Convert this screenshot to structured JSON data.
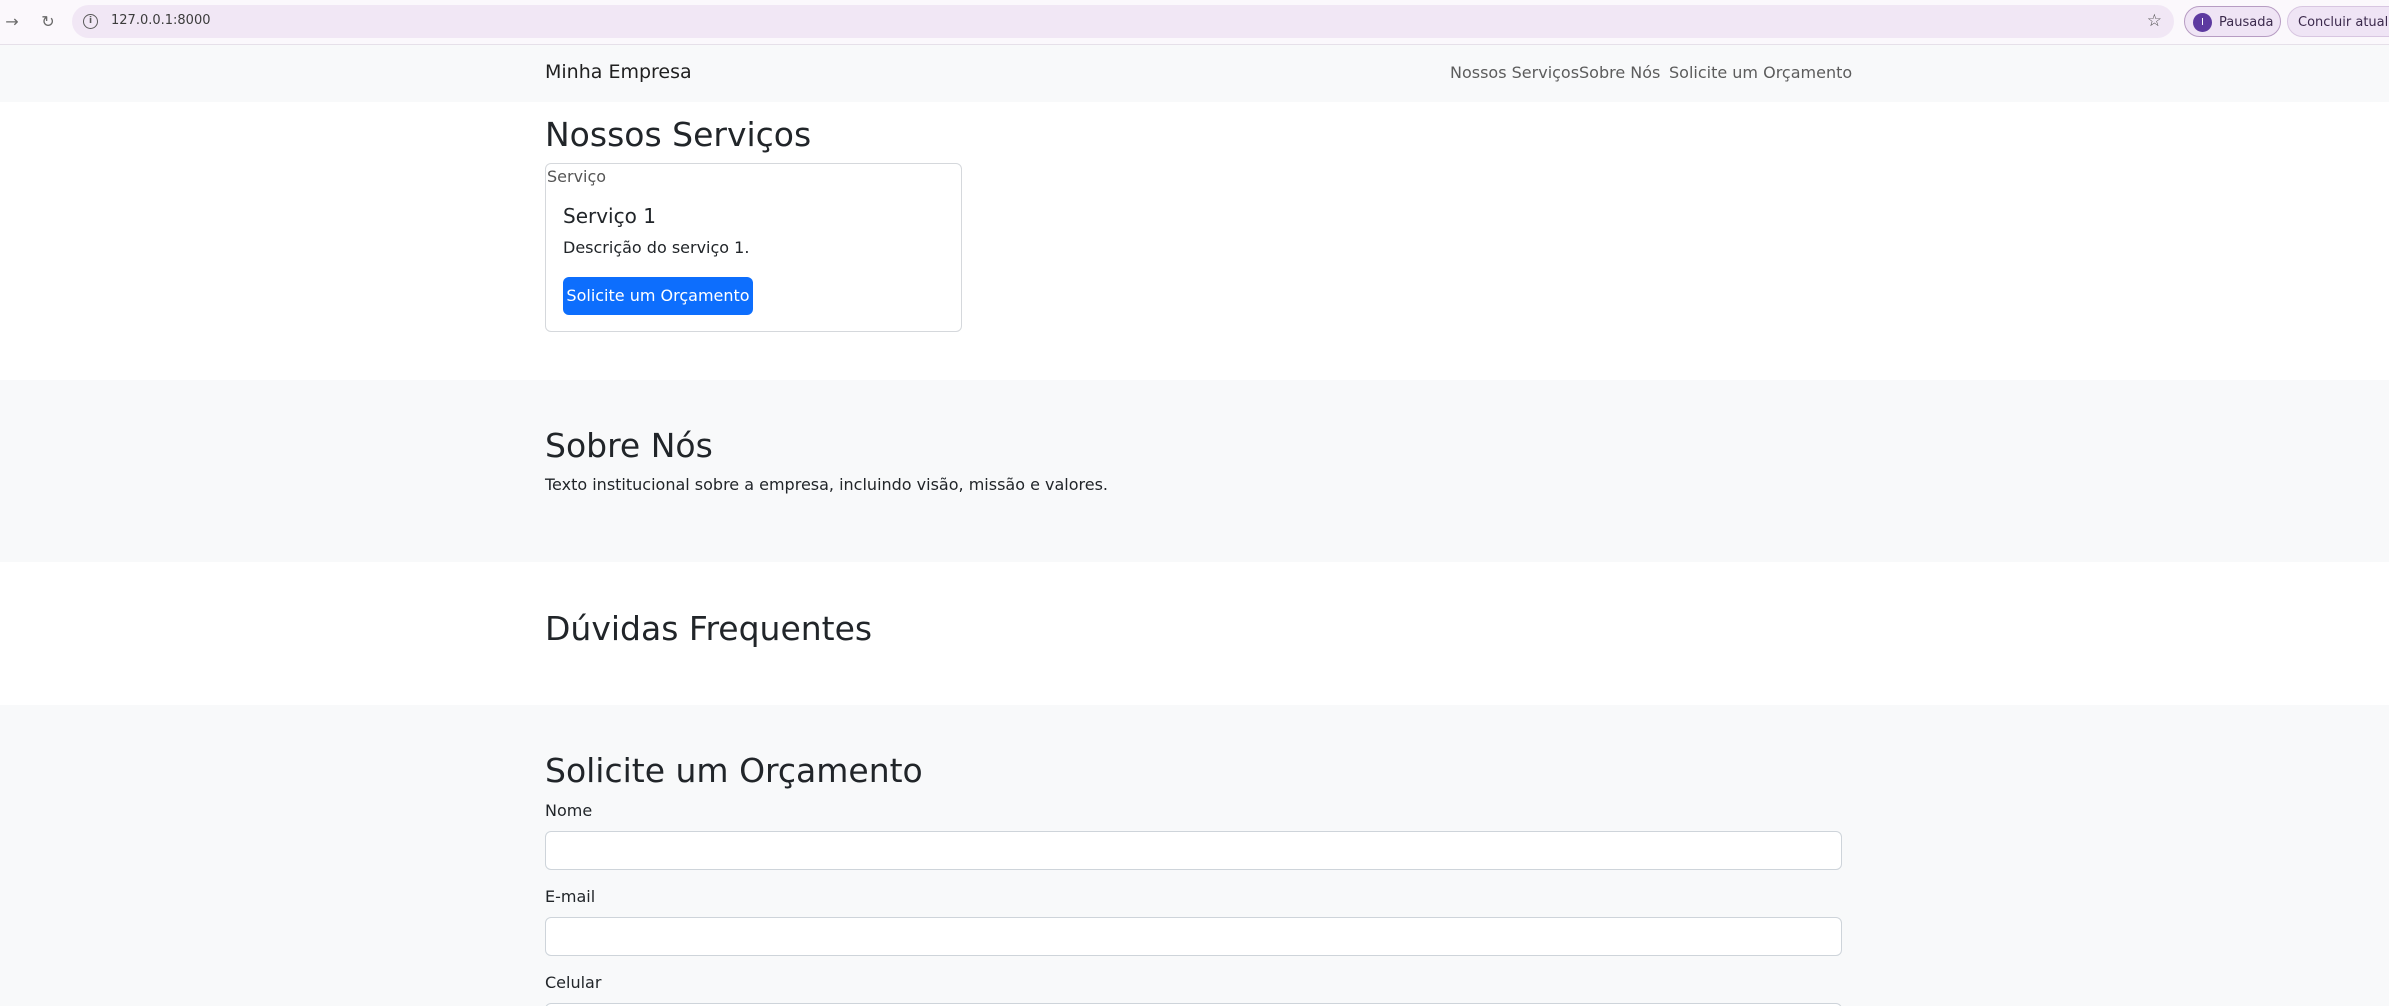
{
  "browser": {
    "url": "127.0.0.1:8000",
    "profile_initial": "I",
    "profile_status": "Pausada",
    "update_button": "Concluir atualiza"
  },
  "navbar": {
    "brand": "Minha Empresa",
    "links": [
      "Nossos Serviços",
      "Sobre Nós",
      "Solicite um Orçamento"
    ]
  },
  "services": {
    "heading": "Nossos Serviços",
    "cards": [
      {
        "image_alt": "Serviço",
        "title": "Serviço 1",
        "description": "Descrição do serviço 1.",
        "button": "Solicite um Orçamento"
      }
    ]
  },
  "about": {
    "heading": "Sobre Nós",
    "text": "Texto institucional sobre a empresa, incluindo visão, missão e valores."
  },
  "faq": {
    "heading": "Dúvidas Frequentes"
  },
  "quote_form": {
    "heading": "Solicite um Orçamento",
    "fields": [
      {
        "label": "Nome",
        "value": ""
      },
      {
        "label": "E-mail",
        "value": ""
      },
      {
        "label": "Celular",
        "value": ""
      }
    ]
  },
  "colors": {
    "primary": "#0d6efd",
    "section_gray": "#f8f9fa",
    "text": "#212529"
  }
}
